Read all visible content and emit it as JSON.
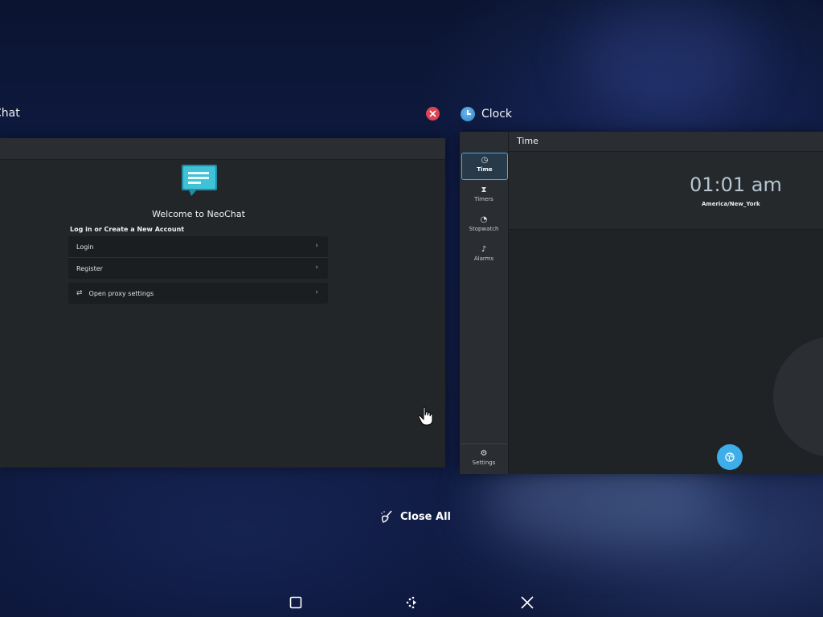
{
  "tasks": [
    {
      "title": "Chat",
      "app": "NeoChat",
      "welcome": "Welcome to NeoChat",
      "subheading": "Log in or Create a New Account",
      "items": [
        {
          "label": "Login"
        },
        {
          "label": "Register"
        }
      ],
      "proxy_label": "Open proxy settings",
      "chevron": "›"
    },
    {
      "title": "Clock",
      "header_title": "Time",
      "time": "01:01 am",
      "timezone": "America/New_York",
      "sidebar": [
        {
          "label": "Time",
          "icon": "clock-icon"
        },
        {
          "label": "Timers",
          "icon": "timer-icon"
        },
        {
          "label": "Stopwatch",
          "icon": "stopwatch-icon"
        },
        {
          "label": "Alarms",
          "icon": "bell-icon"
        }
      ],
      "settings_label": "Settings"
    }
  ],
  "close_all_label": "Close All",
  "colors": {
    "accent": "#3daee9",
    "close_red": "#da4453",
    "window_bg": "#232629"
  }
}
